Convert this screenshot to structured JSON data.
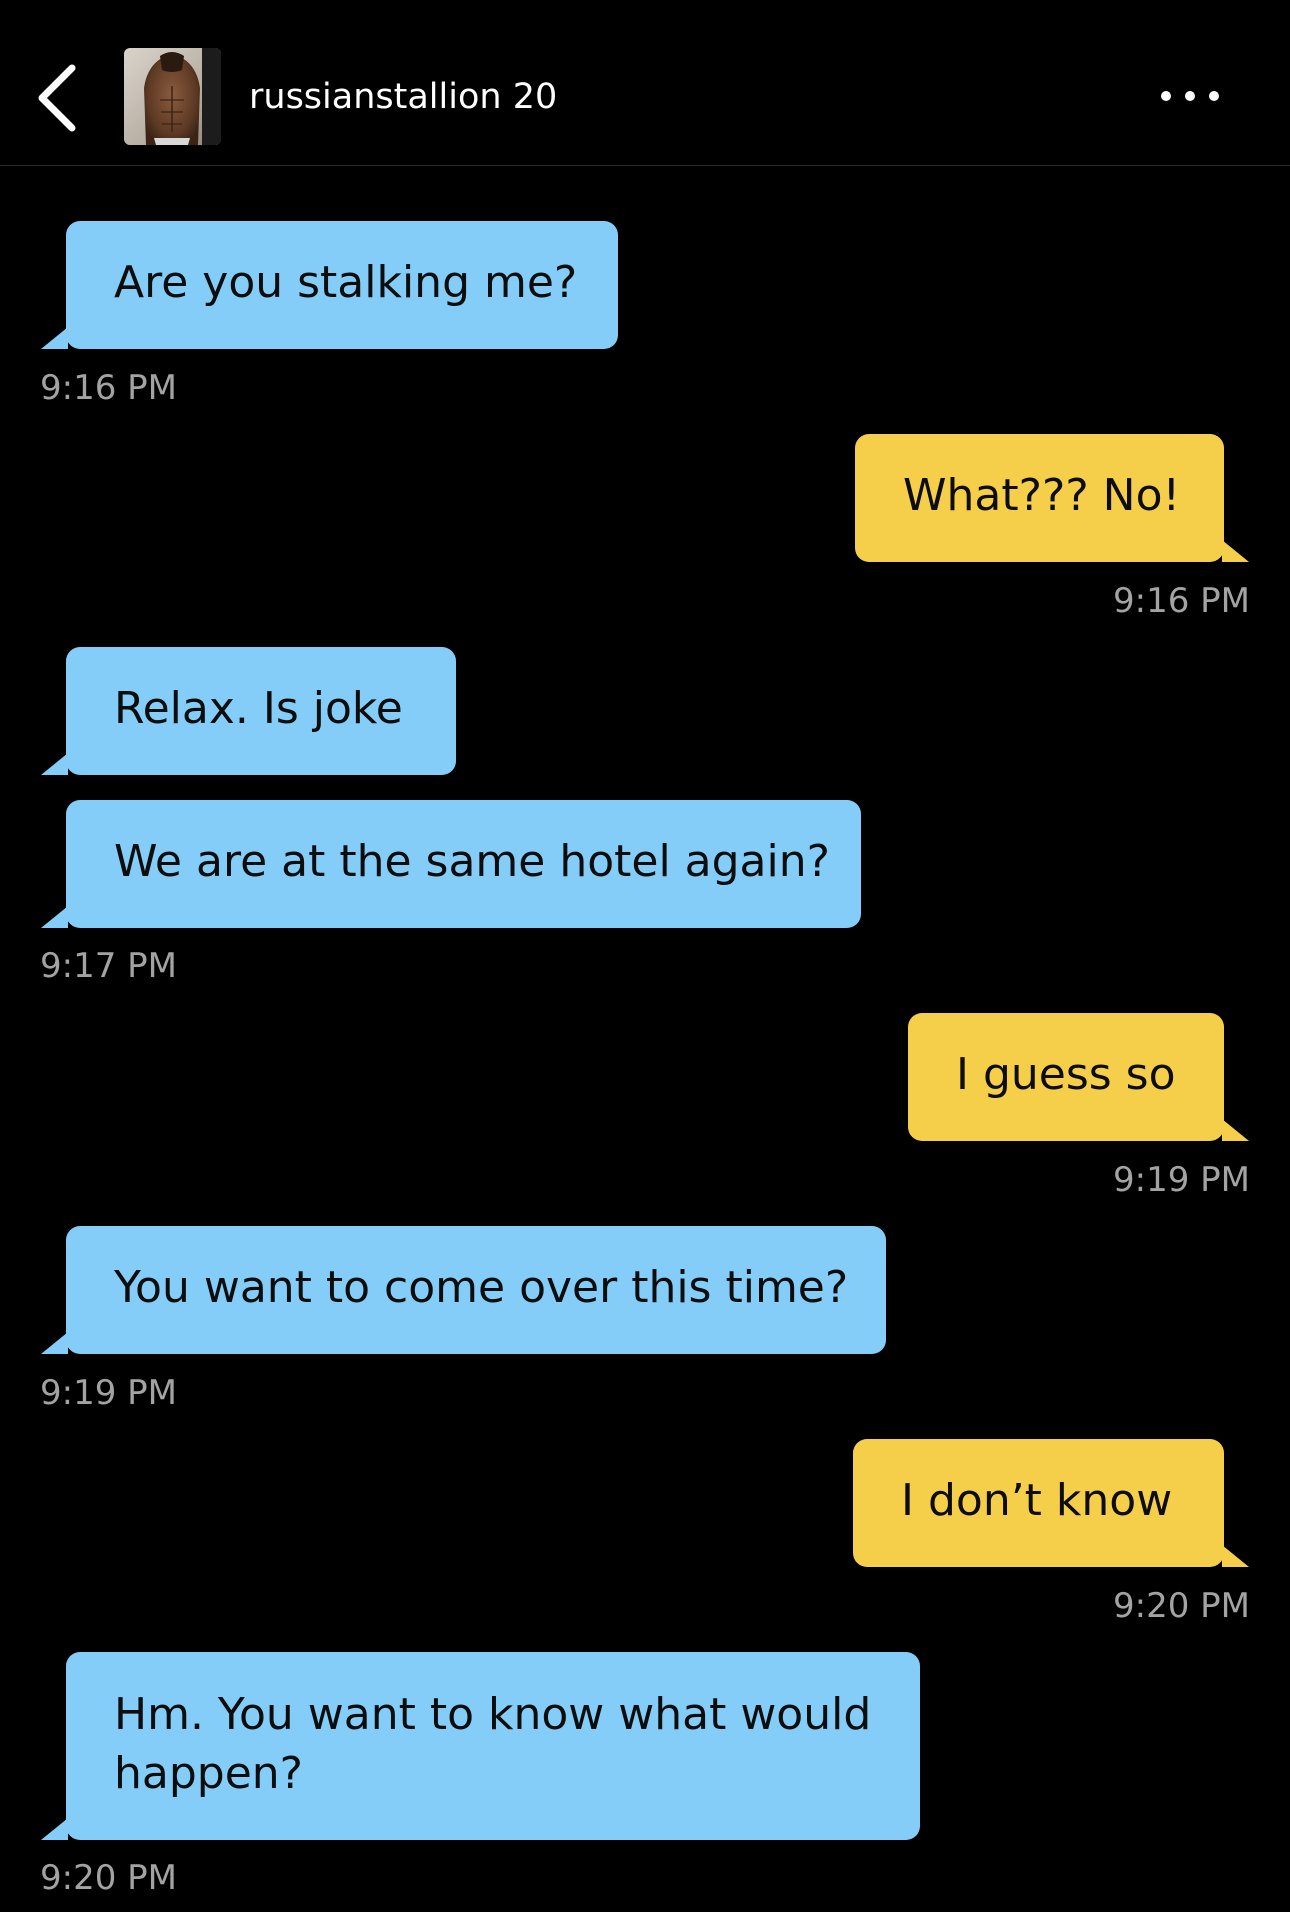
{
  "header": {
    "back_icon": "chevron-left-icon",
    "username": "russianstallion 20",
    "more_icon": "more-horizontal-icon"
  },
  "messages": [
    {
      "direction": "incoming",
      "text": "Are you stalking me?"
    },
    {
      "direction": "incoming",
      "time": "9:16 PM"
    },
    {
      "direction": "outgoing",
      "text": "What??? No!"
    },
    {
      "direction": "outgoing",
      "time": "9:16 PM"
    },
    {
      "direction": "incoming",
      "text": "Relax. Is joke"
    },
    {
      "direction": "incoming",
      "text": "We are at the same hotel again?"
    },
    {
      "direction": "incoming",
      "time": "9:17 PM"
    },
    {
      "direction": "outgoing",
      "text": "I guess so"
    },
    {
      "direction": "outgoing",
      "time": "9:19 PM"
    },
    {
      "direction": "incoming",
      "text": "You want to come over this time?"
    },
    {
      "direction": "incoming",
      "time": "9:19 PM"
    },
    {
      "direction": "outgoing",
      "text": "I don’t know"
    },
    {
      "direction": "outgoing",
      "time": "9:20 PM"
    },
    {
      "direction": "incoming",
      "text": "Hm. You want to know what would happen?"
    },
    {
      "direction": "incoming",
      "time": "9:20 PM"
    }
  ],
  "colors": {
    "background": "#000000",
    "incoming_bubble": "#84cdf8",
    "outgoing_bubble": "#f6cf4a",
    "timestamp": "#a3a3a3"
  }
}
